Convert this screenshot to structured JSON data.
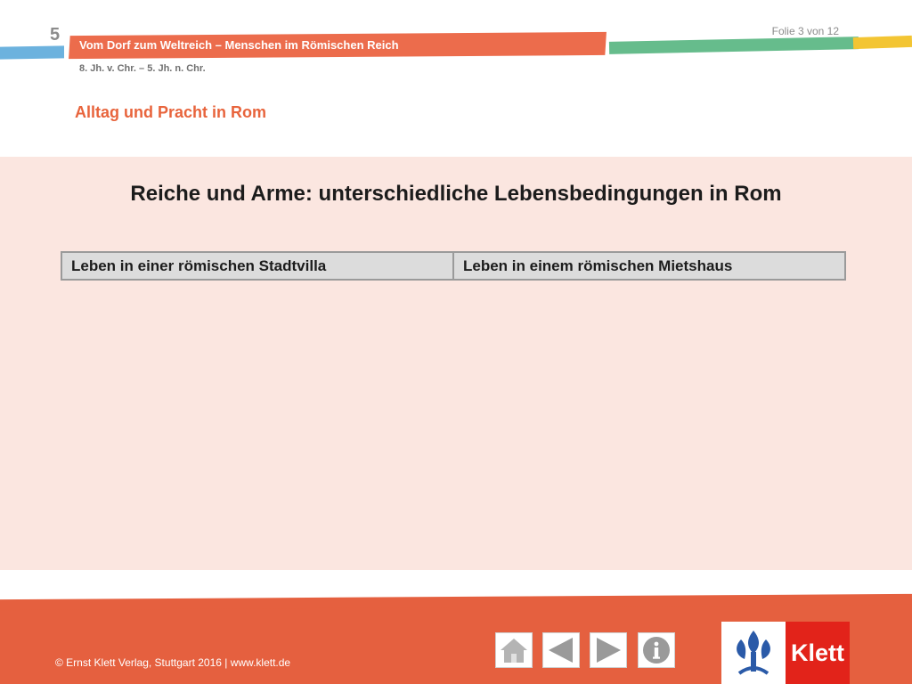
{
  "header": {
    "chapter_number": "5",
    "chapter_title": "Vom Dorf zum Weltreich – Menschen im Römischen Reich",
    "period": "8. Jh. v. Chr. – 5. Jh. n. Chr.",
    "slide_counter": "Folie 3 von 12",
    "section_title": "Alltag und Pracht in Rom"
  },
  "content": {
    "heading": "Reiche und Arme: unterschiedliche Lebensbedingungen in Rom",
    "table": {
      "columns": [
        "Leben in einer römischen Stadtvilla",
        "Leben in einem römischen Mietshaus"
      ]
    }
  },
  "footer": {
    "copyright": "© Ernst Klett Verlag, Stuttgart 2016 | www.klett.de",
    "nav": [
      "home-icon",
      "arrow-left-icon",
      "arrow-right-icon",
      "info-icon"
    ],
    "logo_text": "Klett"
  },
  "colors": {
    "accent_orange": "#ec6c4c",
    "stripe_blue": "#6cb2de",
    "stripe_green": "#66bc8c",
    "stripe_yellow": "#f3c533",
    "content_bg": "#fbe6e0",
    "footer_bg": "#e5603f",
    "brand_red": "#e2231a"
  }
}
